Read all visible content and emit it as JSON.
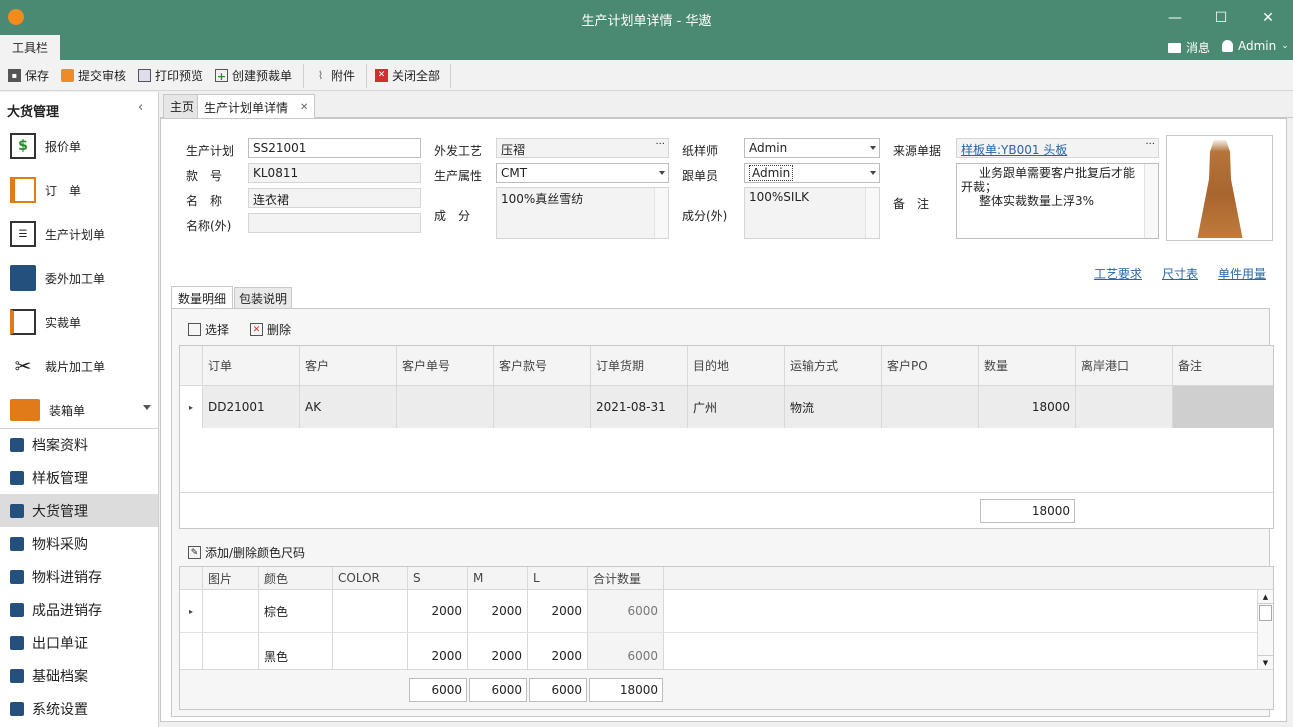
{
  "window": {
    "title": "生产计划单详情 - 华遨",
    "minimize": "—",
    "maximize": "☐",
    "close": "✕"
  },
  "menubar": {
    "tab": "工具栏",
    "messages": "消息",
    "user": "Admin"
  },
  "toolbar": {
    "save": "保存",
    "submit": "提交审核",
    "print": "打印预览",
    "create_pre_cut": "创建预裁单",
    "attachment": "附件",
    "close_all": "关闭全部"
  },
  "sidebar": {
    "title": "大货管理",
    "big_items": [
      {
        "label": "报价单",
        "icon": "dollar-doc-icon"
      },
      {
        "label": "订　单",
        "icon": "order-doc-icon"
      },
      {
        "label": "生产计划单",
        "icon": "checklist-icon"
      },
      {
        "label": "委外加工单",
        "icon": "factory-icon"
      },
      {
        "label": "实裁单",
        "icon": "clipboard-icon"
      },
      {
        "label": "裁片加工单",
        "icon": "scissors-icon"
      },
      {
        "label": "装箱单",
        "icon": "box-icon"
      }
    ],
    "nav": [
      {
        "label": "档案资料",
        "icon": "shirt-icon"
      },
      {
        "label": "样板管理",
        "icon": "sample-icon"
      },
      {
        "label": "大货管理",
        "icon": "list-icon"
      },
      {
        "label": "物料采购",
        "icon": "cart-icon"
      },
      {
        "label": "物料进销存",
        "icon": "house-icon"
      },
      {
        "label": "成品进销存",
        "icon": "house-icon"
      },
      {
        "label": "出口单证",
        "icon": "card-icon"
      },
      {
        "label": "基础档案",
        "icon": "grid-icon"
      },
      {
        "label": "系统设置",
        "icon": "tools-icon"
      }
    ]
  },
  "tabs": {
    "home": "主页",
    "detail": "生产计划单详情"
  },
  "form": {
    "plan_label": "生产计划",
    "plan_value": "SS21001",
    "style_no_label": "款　号",
    "style_no_value": "KL0811",
    "name_label": "名　称",
    "name_value": "连衣裙",
    "name_ext_label": "名称(外)",
    "name_ext_value": "",
    "outsource_label": "外发工艺",
    "outsource_value": "压褶",
    "attr_label": "生产属性",
    "attr_value": "CMT",
    "composition_label": "成　分",
    "composition_value": "100%真丝雪纺",
    "pattern_maker_label": "纸样师",
    "pattern_maker_value": "Admin",
    "follower_label": "跟单员",
    "follower_value": "Admin",
    "composition_ext_label": "成分(外)",
    "composition_ext_value": "100%SILK",
    "source_label": "来源单据",
    "source_value": "样板单:YB001 头板",
    "remark_label": "备　注",
    "remark_line1": "业务跟单需要客户批复后才能",
    "remark_line2": "开裁；",
    "remark_line3": "整体实裁数量上浮3%"
  },
  "links": {
    "process": "工艺要求",
    "size_chart": "尺寸表",
    "unit_usage": "单件用量"
  },
  "subtabs": {
    "qty": "数量明细",
    "pack": "包装说明"
  },
  "grid1": {
    "select": "选择",
    "delete": "删除",
    "headers": [
      "订单",
      "客户",
      "客户单号",
      "客户款号",
      "订单货期",
      "目的地",
      "运输方式",
      "客户PO",
      "数量",
      "离岸港口",
      "备注"
    ],
    "row": [
      "DD21001",
      "AK",
      "",
      "",
      "2021-08-31",
      "广州",
      "物流",
      "",
      "18000",
      "",
      ""
    ],
    "total": "18000"
  },
  "grid2": {
    "add_color": "添加/删除颜色尺码",
    "headers": [
      "图片",
      "颜色",
      "COLOR",
      "S",
      "M",
      "L",
      "合计数量"
    ],
    "rows": [
      [
        "",
        "棕色",
        "",
        "2000",
        "2000",
        "2000",
        "6000"
      ],
      [
        "",
        "黑色",
        "",
        "2000",
        "2000",
        "2000",
        "6000"
      ]
    ],
    "totals": [
      "6000",
      "6000",
      "6000",
      "18000"
    ]
  }
}
